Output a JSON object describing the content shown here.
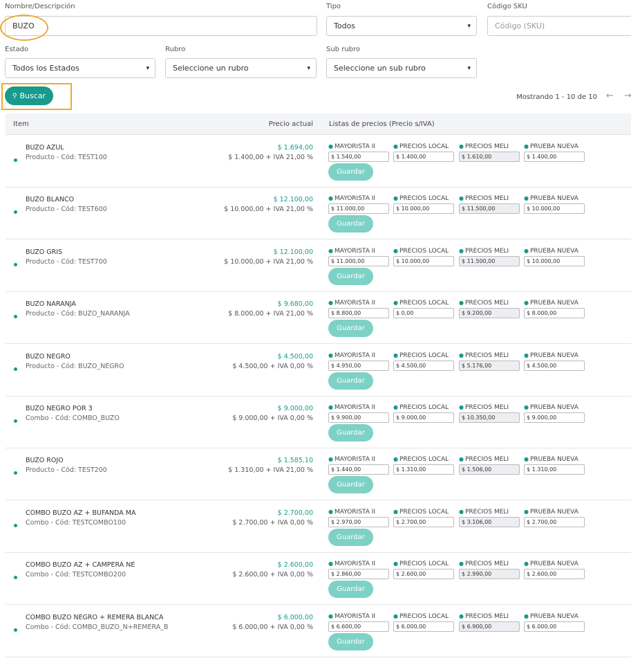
{
  "filters": {
    "name_label": "Nombre/Descripción",
    "name_value": "BUZO",
    "tipo_label": "Tipo",
    "tipo_value": "Todos",
    "sku_label": "Código SKU",
    "sku_placeholder": "Código (SKU)",
    "estado_label": "Estado",
    "estado_value": "Todos los Estados",
    "rubro_label": "Rubro",
    "rubro_value": "Seleccione un rubro",
    "subrubro_label": "Sub rubro",
    "subrubro_value": "Seleccione un sub rubro",
    "search_label": "Buscar",
    "search_icon": "search-icon"
  },
  "pager": {
    "text": "Mostrando 1 - 10 de 10",
    "prev": "←",
    "next": "→"
  },
  "table": {
    "headers": {
      "item": "Item",
      "precio": "Precio actual",
      "listas": "Listas de precios (Precio s/IVA)"
    },
    "list_names": [
      "MAYORISTA II",
      "PRECIOS LOCAL",
      "PRECIOS MELI",
      "PRUEBA NUEVA"
    ],
    "save_label": "Guardar",
    "rows": [
      {
        "name": "BUZO AZUL",
        "sub": "Producto - Cód: TEST100",
        "price": "$ 1.694,00",
        "detail": "$ 1.400,00 + IVA 21,00 %",
        "lists": [
          "$ 1.540,00",
          "$ 1.400,00",
          "$ 1.610,00",
          "$ 1.400,00"
        ]
      },
      {
        "name": "BUZO BLANCO",
        "sub": "Producto - Cód: TEST600",
        "price": "$ 12.100,00",
        "detail": "$ 10.000,00 + IVA 21,00 %",
        "lists": [
          "$ 11.000,00",
          "$ 10.000,00",
          "$ 11.500,00",
          "$ 10.000,00"
        ]
      },
      {
        "name": "BUZO GRIS",
        "sub": "Producto - Cód: TEST700",
        "price": "$ 12.100,00",
        "detail": "$ 10.000,00 + IVA 21,00 %",
        "lists": [
          "$ 11.000,00",
          "$ 10.000,00",
          "$ 11.500,00",
          "$ 10.000,00"
        ]
      },
      {
        "name": "BUZO NARANJA",
        "sub": "Producto - Cód: BUZO_NARANJA",
        "price": "$ 9.680,00",
        "detail": "$ 8.000,00 + IVA 21,00 %",
        "lists": [
          "$ 8.800,00",
          "$ 0,00",
          "$ 9.200,00",
          "$ 8.000,00"
        ]
      },
      {
        "name": "BUZO NEGRO",
        "sub": "Producto - Cód: BUZO_NEGRO",
        "price": "$ 4.500,00",
        "detail": "$ 4.500,00 + IVA 0,00 %",
        "lists": [
          "$ 4.950,00",
          "$ 4.500,00",
          "$ 5.176,00",
          "$ 4.500,00"
        ]
      },
      {
        "name": "BUZO NEGRO POR 3",
        "sub": "Combo - Cód: COMBO_BUZO",
        "price": "$ 9.000,00",
        "detail": "$ 9.000,00 + IVA 0,00 %",
        "lists": [
          "$ 9.900,00",
          "$ 9.000,00",
          "$ 10.350,00",
          "$ 9.000,00"
        ]
      },
      {
        "name": "BUZO ROJO",
        "sub": "Producto - Cód: TEST200",
        "price": "$ 1.585,10",
        "detail": "$ 1.310,00 + IVA 21,00 %",
        "lists": [
          "$ 1.440,00",
          "$ 1.310,00",
          "$ 1.506,00",
          "$ 1.310,00"
        ]
      },
      {
        "name": "COMBO BUZO AZ + BUFANDA MA",
        "sub": "Combo - Cód: TESTCOMBO100",
        "price": "$ 2.700,00",
        "detail": "$ 2.700,00 + IVA 0,00 %",
        "lists": [
          "$ 2.970,00",
          "$ 2.700,00",
          "$ 3.106,00",
          "$ 2.700,00"
        ]
      },
      {
        "name": "COMBO BUZO AZ + CAMPERA NE",
        "sub": "Combo - Cód: TESTCOMBO200",
        "price": "$ 2.600,00",
        "detail": "$ 2.600,00 + IVA 0,00 %",
        "lists": [
          "$ 2.860,00",
          "$ 2.600,00",
          "$ 2.990,00",
          "$ 2.600,00"
        ]
      },
      {
        "name": "COMBO BUZO NEGRO + REMERA BLANCA",
        "sub": "Combo - Cód: COMBO_BUZO_N+REMERA_B",
        "price": "$ 6.000,00",
        "detail": "$ 6.000,00 + IVA 0,00 %",
        "lists": [
          "$ 6.600,00",
          "$ 6.000,00",
          "$ 6.900,00",
          "$ 6.000,00"
        ]
      }
    ]
  },
  "colors": {
    "accent": "#189a8c",
    "save_button": "#7dd1c5",
    "highlight": "#f0a830"
  }
}
